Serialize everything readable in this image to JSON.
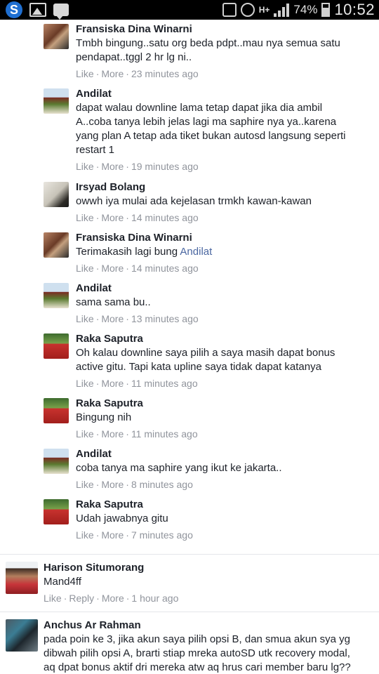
{
  "status_bar": {
    "app_icon": "S",
    "battery": "74%",
    "time": "10:52",
    "network": "H+"
  },
  "actions": {
    "like": "Like",
    "reply": "Reply",
    "more": "More",
    "dot": "·"
  },
  "replies": [
    {
      "name": "Fransiska Dina Winarni",
      "lines": [
        "Tmbh bingung..satu org beda pdpt..mau nya semua satu",
        "pendapat..tggl 2 hr lg ni.."
      ],
      "time": "23 minutes ago",
      "avatar": "photo-couple"
    },
    {
      "name": "Andilat",
      "lines": [
        "dapat walau downline lama tetap dapat jika dia ambil",
        "A..coba tanya lebih jelas lagi ma saphire nya ya..karena",
        "yang plan A tetap ada tiket bukan autosd langsung seperti",
        "restart 1"
      ],
      "time": "19 minutes ago",
      "avatar": "photo-bus"
    },
    {
      "name": "Irsyad Bolang",
      "lines": [
        "owwh iya mulai ada kejelasan trmkh kawan-kawan"
      ],
      "time": "14 minutes ago",
      "avatar": "photo-man"
    },
    {
      "name": "Fransiska Dina Winarni",
      "lines": [
        "Terimakasih lagi bung "
      ],
      "tag": "Andilat",
      "time": "14 minutes ago",
      "avatar": "photo-couple"
    },
    {
      "name": "Andilat",
      "lines": [
        "sama sama bu.."
      ],
      "time": "13 minutes ago",
      "avatar": "photo-bus"
    },
    {
      "name": "Raka Saputra",
      "lines": [
        "Oh kalau downline saya pilih a saya masih dapat bonus",
        "active gitu. Tapi kata upline saya tidak dapat katanya"
      ],
      "time": "11 minutes ago",
      "avatar": "photo-red-shirt"
    },
    {
      "name": "Raka Saputra",
      "lines": [
        "Bingung nih"
      ],
      "time": "11 minutes ago",
      "avatar": "photo-red-shirt"
    },
    {
      "name": "Andilat",
      "lines": [
        "coba tanya ma saphire yang ikut ke jakarta.."
      ],
      "time": "8 minutes ago",
      "avatar": "photo-bus"
    },
    {
      "name": "Raka Saputra",
      "lines": [
        "Udah jawabnya gitu"
      ],
      "time": "7 minutes ago",
      "avatar": "photo-red-shirt"
    }
  ],
  "comments": [
    {
      "name": "Harison Situmorang",
      "lines": [
        "Mand4ff"
      ],
      "time": "1 hour ago",
      "avatar": "photo-man-red"
    },
    {
      "name": "Anchus Ar Rahman",
      "lines": [
        "pada poin ke 3, jika akun saya pilih opsi B, dan smua akun sya yg",
        "dibwah pilih opsi A, brarti stiap mreka autoSD utk recovery modal,",
        "aq dpat bonus aktif dri mereka atw aq hrus cari member baru lg??"
      ],
      "time": "",
      "avatar": "photo-group"
    }
  ],
  "colors": {
    "name": "#1d2129",
    "meta": "#90949c",
    "tag": "#4b67a1"
  }
}
